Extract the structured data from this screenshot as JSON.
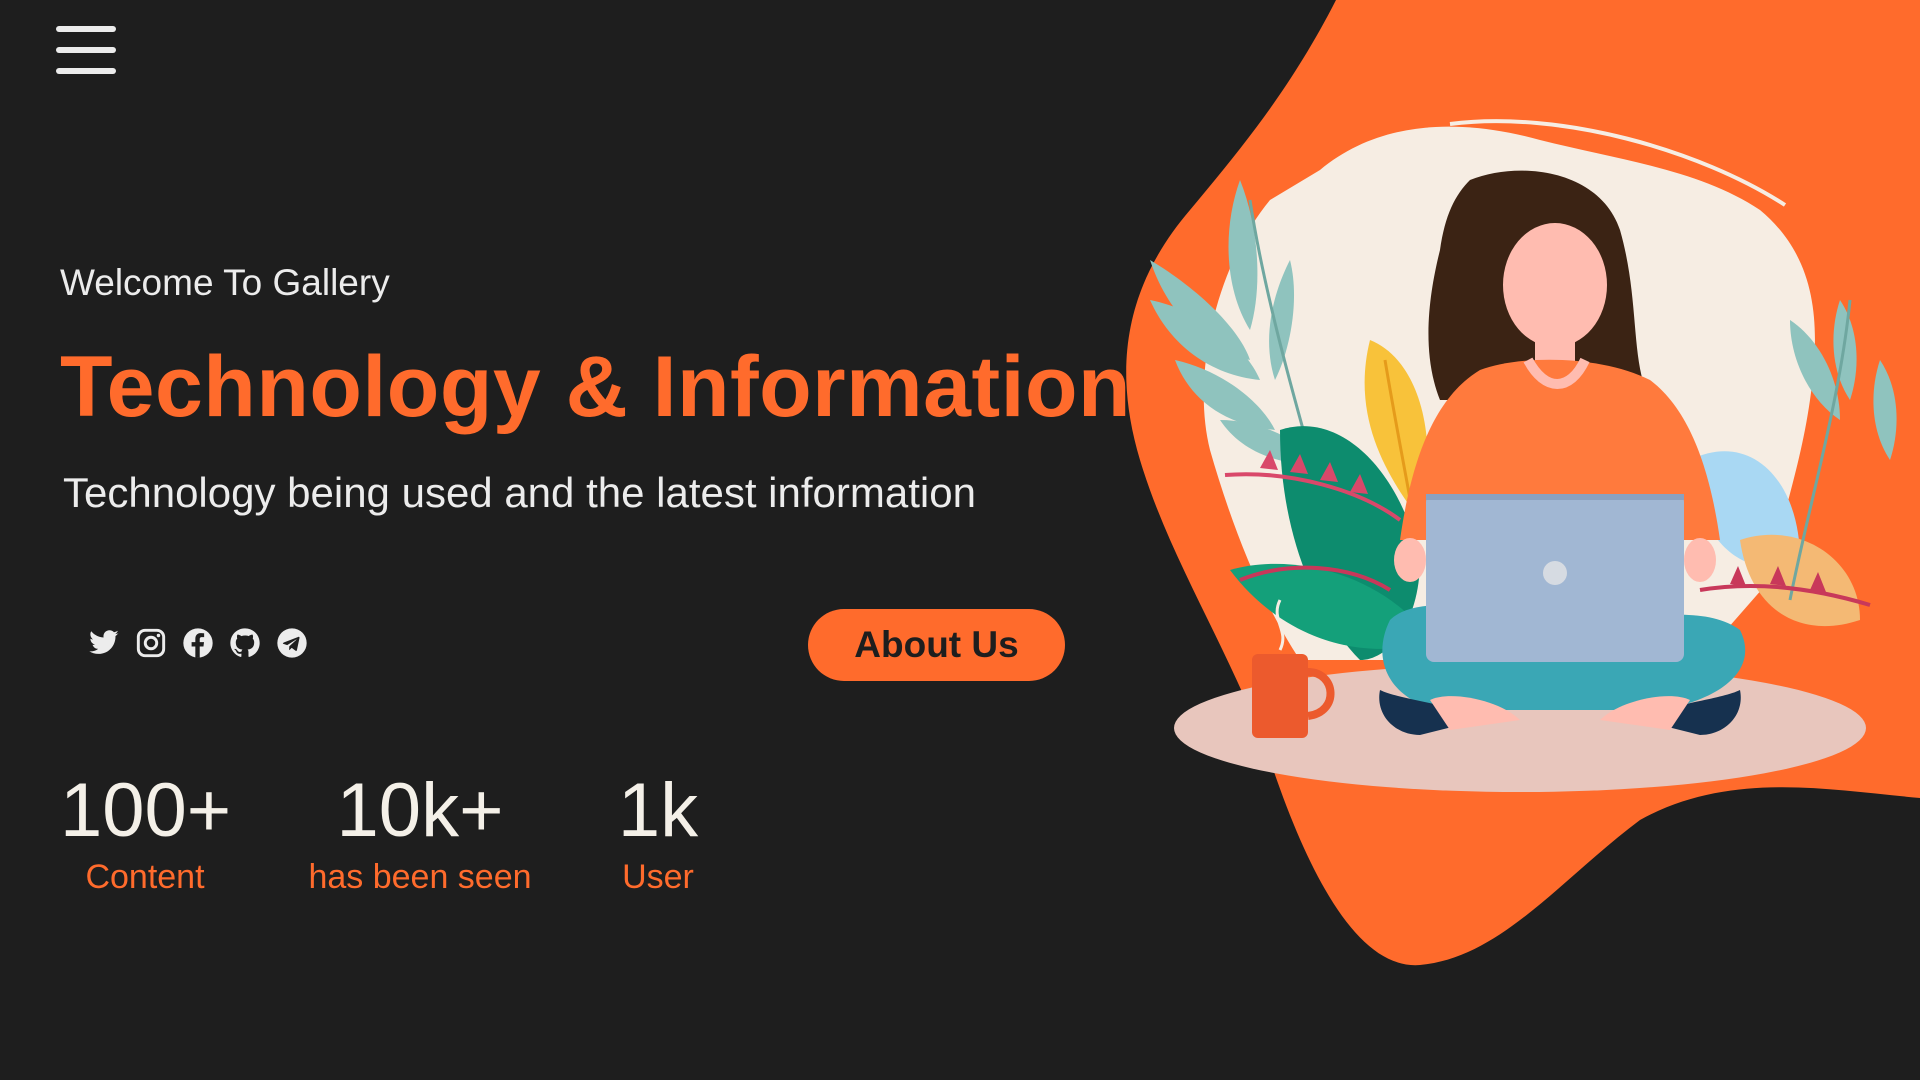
{
  "header": {
    "menu_icon": "hamburger-menu-icon"
  },
  "hero": {
    "welcome": "Welcome To Gallery",
    "title": "Technology & Information",
    "subtitle": "Technology being used and the latest information",
    "about_button": "About Us"
  },
  "socials": [
    {
      "name": "twitter",
      "icon": "twitter-icon"
    },
    {
      "name": "instagram",
      "icon": "instagram-icon"
    },
    {
      "name": "facebook",
      "icon": "facebook-icon"
    },
    {
      "name": "github",
      "icon": "github-icon"
    },
    {
      "name": "telegram",
      "icon": "telegram-icon"
    }
  ],
  "stats": [
    {
      "value": "100+",
      "label": "Content"
    },
    {
      "value": "10k+",
      "label": "has been seen"
    },
    {
      "value": "1k",
      "label": "User"
    }
  ],
  "illustration": {
    "subject": "woman-with-laptop-illustration"
  },
  "colors": {
    "background": "#1e1e1e",
    "accent": "#ff6b2c",
    "text": "#ececec",
    "stat_value": "#f4f0e8"
  }
}
